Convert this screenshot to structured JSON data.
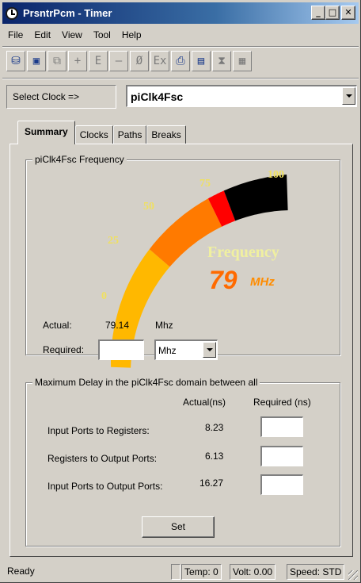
{
  "window": {
    "title": "PrsntrPcm - Timer",
    "min_label": "_",
    "max_label": "□",
    "close_label": "✕"
  },
  "menu": [
    "File",
    "Edit",
    "View",
    "Tool",
    "Help"
  ],
  "toolbar": [
    {
      "icon": "database-icon",
      "glyph": "⛁"
    },
    {
      "icon": "save-icon",
      "glyph": "▣"
    },
    {
      "icon": "copy-icon",
      "glyph": "⧉"
    },
    {
      "icon": "plus-icon",
      "glyph": "+"
    },
    {
      "icon": "e-icon",
      "glyph": "E"
    },
    {
      "icon": "minus-icon",
      "glyph": "—"
    },
    {
      "icon": "null-icon",
      "glyph": "Ø"
    },
    {
      "icon": "ex-icon",
      "glyph": "Ex"
    },
    {
      "icon": "print-icon",
      "glyph": "⎙"
    },
    {
      "icon": "preview-icon",
      "glyph": "▤"
    },
    {
      "icon": "hourglass-icon",
      "glyph": "⧗"
    },
    {
      "icon": "schematic-icon",
      "glyph": "▦"
    }
  ],
  "clock": {
    "label": "Select Clock =>",
    "value": "piClk4Fsc"
  },
  "tabs": [
    "Summary",
    "Clocks",
    "Paths",
    "Breaks"
  ],
  "frequency": {
    "legend": "piClk4Fsc Frequency",
    "gauge_label": "Frequency",
    "gauge_value": "79",
    "gauge_unit": "MHz",
    "gauge_fraction": 0.79,
    "ticks": [
      "0",
      "25",
      "50",
      "75",
      "100"
    ],
    "actual_label": "Actual:",
    "actual_value": "79.14",
    "actual_unit": "Mhz",
    "required_label": "Required:",
    "required_value": "",
    "required_unit": "Mhz",
    "colors": {
      "low": "#ffb800",
      "mid": "#ff7a00",
      "limit": "#ff0000",
      "high": "#000000",
      "text": "#f0f0a0",
      "value": "#ff6a00"
    }
  },
  "delay": {
    "legend": "Maximum Delay in the piClk4Fsc domain between all",
    "header_actual": "Actual(ns)",
    "header_required": "Required (ns)",
    "rows": [
      {
        "label": "Input Ports to Registers:",
        "actual": "8.23",
        "required": ""
      },
      {
        "label": "Registers to Output Ports:",
        "actual": "6.13",
        "required": ""
      },
      {
        "label": "Input Ports to Output Ports:",
        "actual": "16.27",
        "required": ""
      }
    ],
    "set_label": "Set"
  },
  "status": {
    "ready": "Ready",
    "temp": "Temp: 0",
    "volt": "Volt: 0.00",
    "speed": "Speed: STD"
  }
}
